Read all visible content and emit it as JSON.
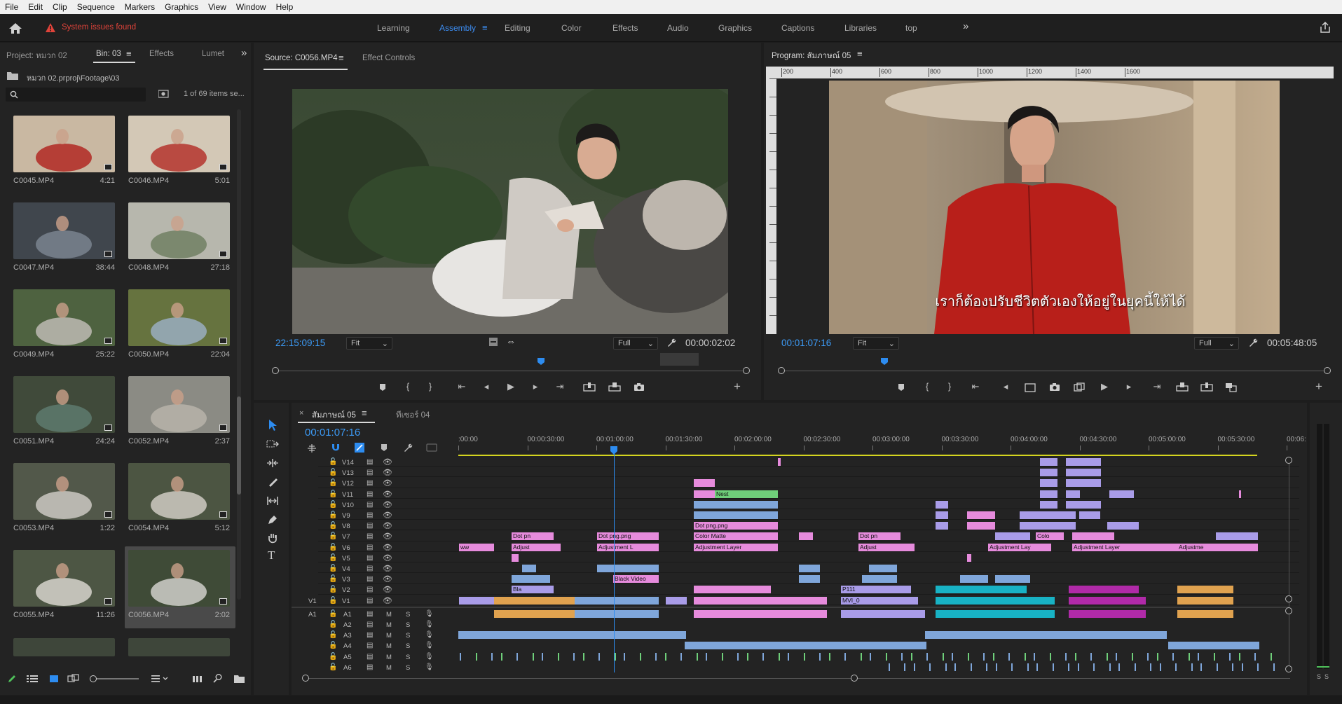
{
  "menu": [
    "File",
    "Edit",
    "Clip",
    "Sequence",
    "Markers",
    "Graphics",
    "View",
    "Window",
    "Help"
  ],
  "app_bar": {
    "warning_text": "System issues found",
    "workspaces": [
      {
        "label": "Learning",
        "active": false
      },
      {
        "label": "Assembly",
        "active": true
      },
      {
        "label": "Editing",
        "active": false
      },
      {
        "label": "Color",
        "active": false
      },
      {
        "label": "Effects",
        "active": false
      },
      {
        "label": "Audio",
        "active": false
      },
      {
        "label": "Graphics",
        "active": false
      },
      {
        "label": "Captions",
        "active": false
      },
      {
        "label": "Libraries",
        "active": false
      },
      {
        "label": "top",
        "active": false
      }
    ],
    "more_label": "»"
  },
  "project_panel": {
    "tabs": [
      "Project: หมวก 02",
      "Bin: 03",
      "Effects",
      "Lumet"
    ],
    "more_label": "»",
    "path": "หมวก 02.prproj\\Footage\\03",
    "items_count": "1 of 69 items se...",
    "clips": [
      {
        "name": "C0045.MP4",
        "duration": "4:21"
      },
      {
        "name": "C0046.MP4",
        "duration": "5:01"
      },
      {
        "name": "C0047.MP4",
        "duration": "38:44"
      },
      {
        "name": "C0048.MP4",
        "duration": "27:18"
      },
      {
        "name": "C0049.MP4",
        "duration": "25:22"
      },
      {
        "name": "C0050.MP4",
        "duration": "22:04"
      },
      {
        "name": "C0051.MP4",
        "duration": "24:24"
      },
      {
        "name": "C0052.MP4",
        "duration": "2:37"
      },
      {
        "name": "C0053.MP4",
        "duration": "1:22"
      },
      {
        "name": "C0054.MP4",
        "duration": "5:12"
      },
      {
        "name": "C0055.MP4",
        "duration": "11:26"
      },
      {
        "name": "C0056.MP4",
        "duration": "2:02"
      }
    ]
  },
  "source_monitor": {
    "tabs": [
      "Source: C0056.MP4",
      "Effect Controls"
    ],
    "timecode": "22:15:09:15",
    "fit": "Fit",
    "quality": "Full",
    "duration": "00:00:02:02"
  },
  "program_monitor": {
    "tab": "Program: สัมภาษณ์ 05",
    "timecode": "00:01:07:16",
    "fit": "Fit",
    "quality": "Full",
    "duration": "00:05:48:05",
    "subtitle": "เราก็ต้องปรับชีวิตตัวเองให้อยู่ในยุคนี้ให้ได้",
    "ruler_ticks": [
      "200",
      "400",
      "600",
      "800",
      "1000",
      "1200",
      "1400",
      "1600"
    ]
  },
  "timeline": {
    "tabs": [
      "สัมภาษณ์ 05",
      "ทีเซอร์ 04"
    ],
    "timecode": "00:01:07:16",
    "ruler": [
      ":00:00",
      "00:00:30:00",
      "00:01:00:00",
      "00:01:30:00",
      "00:02:00:00",
      "00:02:30:00",
      "00:03:00:00",
      "00:03:30:00",
      "00:04:00:00",
      "00:04:30:00",
      "00:05:00:00",
      "00:05:30:00",
      "00:06:"
    ],
    "video_tracks": [
      "V14",
      "V13",
      "V12",
      "V11",
      "V10",
      "V9",
      "V8",
      "V7",
      "V6",
      "V5",
      "V4",
      "V3",
      "V2",
      "V1"
    ],
    "audio_tracks": [
      "A1",
      "A2",
      "A3",
      "A4",
      "A5",
      "A6"
    ],
    "v1_source": "V1",
    "a1_source": "A1",
    "mute_label": "M",
    "solo_label": "S",
    "clip_labels": {
      "nest": "Nest",
      "dot_png_1": "Dot pn",
      "adjust_1": "Adjust",
      "dot_png_2": "Dot png.png",
      "adjustment_l": "Adjustment L",
      "dot_png_3": "Dot png.png",
      "color_matte": "Color Matte",
      "adjustment_layer_1": "Adjustment Layer",
      "dot_png_4": "Dot pn",
      "adjust_2": "Adjust",
      "colo": "Colo",
      "adjustment_lay": "Adjustment Lay",
      "adjustment_layer_2": "Adjustment Layer",
      "adjustme": "Adjustme",
      "black_video": "Black Video",
      "bla": "Bla",
      "mvi": "MVI_0",
      "p111": "P111",
      "ww": "ww"
    }
  },
  "meter": {
    "labels": [
      "S",
      "S"
    ]
  },
  "colors": {
    "accent_blue": "#3c9af5",
    "warning_red": "#e0433a",
    "clip_pink": "#e68bdc",
    "clip_purple": "#a99ce8",
    "clip_blue": "#7fa6da",
    "clip_green": "#6fcf7a",
    "clip_orange": "#e0a24f",
    "clip_teal": "#18b2c4",
    "clip_magenta": "#b02aa8"
  }
}
